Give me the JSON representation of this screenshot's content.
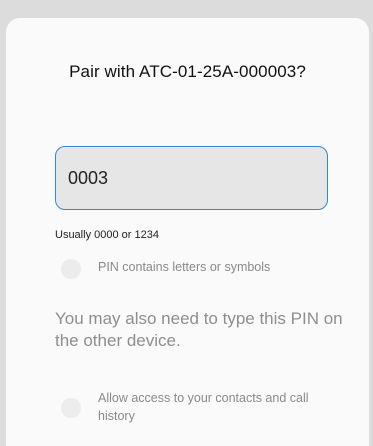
{
  "dialog": {
    "title": "Pair with ATC-01-25A-000003?",
    "pin_field": {
      "value": "0003",
      "placeholder": ""
    },
    "hint": "Usually 0000 or 1234",
    "pin_letters_option": {
      "label": "PIN contains letters or symbols",
      "checked": false
    },
    "info": "You may also need to type this PIN on the other device.",
    "contacts_option": {
      "label": "Allow access to your contacts and call history",
      "checked": false
    }
  },
  "colors": {
    "field_border": "#2f8bd9",
    "dialog_bg": "#fafafa",
    "muted_text": "#8e8e8e"
  }
}
